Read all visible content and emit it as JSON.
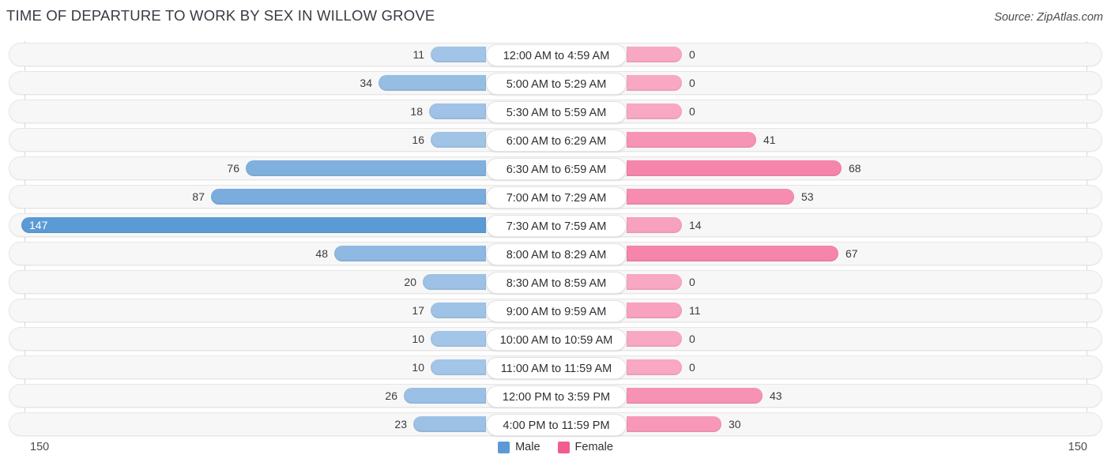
{
  "title": "TIME OF DEPARTURE TO WORK BY SEX IN WILLOW GROVE",
  "source": "Source: ZipAtlas.com",
  "colors": {
    "male": "#5B9BD5",
    "female": "#F25C8E",
    "male_light": "#A8C8E8",
    "female_light": "#F9A8C4",
    "row_bg": "#F7F7F7",
    "row_border": "#E6E6E6",
    "axis_line": "#D8D8D8"
  },
  "legend": {
    "items": [
      {
        "label": "Male",
        "color": "#5B9BD5"
      },
      {
        "label": "Female",
        "color": "#F25C8E"
      }
    ]
  },
  "axis": {
    "left_label": "150",
    "right_label": "150",
    "max": 150
  },
  "chart_data": {
    "type": "bar",
    "orientation": "horizontal-diverging",
    "title": "TIME OF DEPARTURE TO WORK BY SEX IN WILLOW GROVE",
    "xlabel": "",
    "ylabel": "",
    "xlim": [
      150,
      150
    ],
    "grid": false,
    "legend_position": "bottom-center",
    "categories": [
      "12:00 AM to 4:59 AM",
      "5:00 AM to 5:29 AM",
      "5:30 AM to 5:59 AM",
      "6:00 AM to 6:29 AM",
      "6:30 AM to 6:59 AM",
      "7:00 AM to 7:29 AM",
      "7:30 AM to 7:59 AM",
      "8:00 AM to 8:29 AM",
      "8:30 AM to 8:59 AM",
      "9:00 AM to 9:59 AM",
      "10:00 AM to 10:59 AM",
      "11:00 AM to 11:59 AM",
      "12:00 PM to 3:59 PM",
      "4:00 PM to 11:59 PM"
    ],
    "series": [
      {
        "name": "Male",
        "color": "#5B9BD5",
        "values": [
          11,
          34,
          18,
          16,
          76,
          87,
          147,
          48,
          20,
          17,
          10,
          10,
          26,
          23
        ]
      },
      {
        "name": "Female",
        "color": "#F25C8E",
        "values": [
          0,
          0,
          0,
          41,
          68,
          53,
          14,
          67,
          0,
          11,
          0,
          0,
          43,
          30
        ]
      }
    ]
  }
}
